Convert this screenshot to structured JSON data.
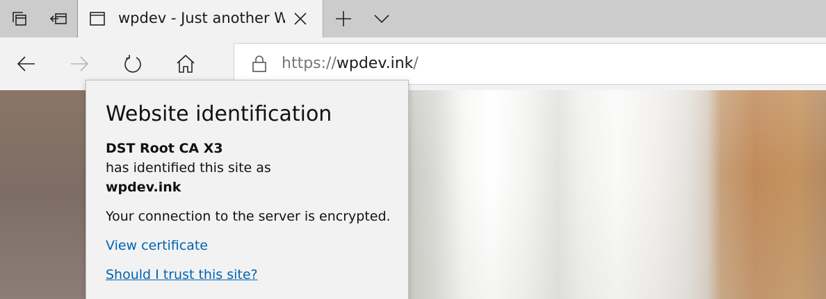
{
  "tabstrip": {
    "buttons": {
      "tabs_aside_icon": "tabs-aside-icon",
      "set_aside_icon": "set-tabs-aside-icon",
      "new_tab_icon": "plus-icon",
      "tab_list_icon": "chevron-down-icon"
    },
    "active_tab": {
      "title": "wpdev - Just another W",
      "favicon": "page-icon",
      "close_icon": "close-icon"
    }
  },
  "navbar": {
    "back_icon": "arrow-left-icon",
    "forward_icon": "arrow-right-icon",
    "refresh_icon": "refresh-icon",
    "home_icon": "home-icon",
    "address": {
      "lock_icon": "lock-icon",
      "scheme": "https://",
      "host": "wpdev.ink",
      "path": "/"
    }
  },
  "flyout": {
    "title": "Website identification",
    "issuer": "DST Root CA X3",
    "identified_text": "has identified this site as",
    "site": "wpdev.ink",
    "encryption_text": "Your connection to the server is encrypted.",
    "view_certificate": "View certificate",
    "trust_link": "Should I trust this site?"
  },
  "colors": {
    "tabstrip_bg": "#cccccc",
    "active_tab_bg": "#f2f2f2",
    "link": "#0063b1",
    "flyout_bg": "#f2f2f2"
  }
}
